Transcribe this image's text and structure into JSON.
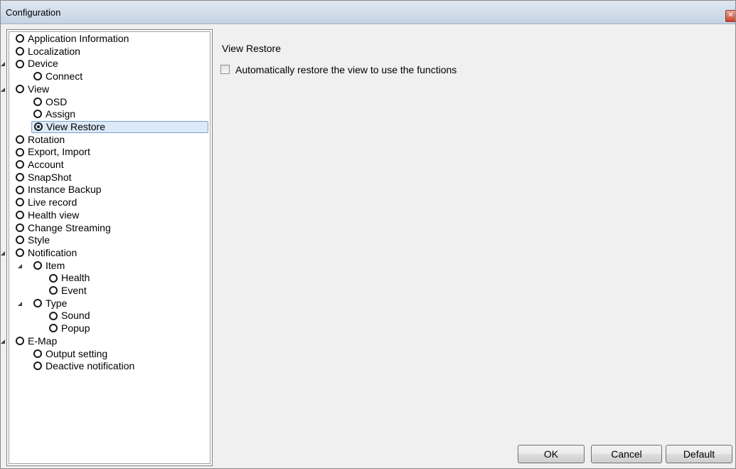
{
  "window": {
    "title": "Configuration",
    "close_icon": "close-icon"
  },
  "tree": {
    "items": [
      {
        "label": "Application Information",
        "level": 0,
        "expanded": null,
        "selected": false
      },
      {
        "label": "Localization",
        "level": 0,
        "expanded": null,
        "selected": false
      },
      {
        "label": "Device",
        "level": 0,
        "expanded": true,
        "selected": false
      },
      {
        "label": "Connect",
        "level": 1,
        "expanded": null,
        "selected": false
      },
      {
        "label": "View",
        "level": 0,
        "expanded": true,
        "selected": false
      },
      {
        "label": "OSD",
        "level": 1,
        "expanded": null,
        "selected": false
      },
      {
        "label": "Assign",
        "level": 1,
        "expanded": null,
        "selected": false
      },
      {
        "label": "View Restore",
        "level": 1,
        "expanded": null,
        "selected": true
      },
      {
        "label": "Rotation",
        "level": 0,
        "expanded": null,
        "selected": false
      },
      {
        "label": "Export, Import",
        "level": 0,
        "expanded": null,
        "selected": false
      },
      {
        "label": "Account",
        "level": 0,
        "expanded": null,
        "selected": false
      },
      {
        "label": "SnapShot",
        "level": 0,
        "expanded": null,
        "selected": false
      },
      {
        "label": "Instance Backup",
        "level": 0,
        "expanded": null,
        "selected": false
      },
      {
        "label": "Live record",
        "level": 0,
        "expanded": null,
        "selected": false
      },
      {
        "label": "Health view",
        "level": 0,
        "expanded": null,
        "selected": false
      },
      {
        "label": "Change Streaming",
        "level": 0,
        "expanded": null,
        "selected": false
      },
      {
        "label": "Style",
        "level": 0,
        "expanded": null,
        "selected": false
      },
      {
        "label": "Notification",
        "level": 0,
        "expanded": true,
        "selected": false
      },
      {
        "label": "Item",
        "level": 1,
        "expanded": true,
        "selected": false
      },
      {
        "label": "Health",
        "level": 2,
        "expanded": null,
        "selected": false
      },
      {
        "label": "Event",
        "level": 2,
        "expanded": null,
        "selected": false
      },
      {
        "label": "Type",
        "level": 1,
        "expanded": true,
        "selected": false
      },
      {
        "label": "Sound",
        "level": 2,
        "expanded": null,
        "selected": false
      },
      {
        "label": "Popup",
        "level": 2,
        "expanded": null,
        "selected": false
      },
      {
        "label": "E-Map",
        "level": 0,
        "expanded": true,
        "selected": false
      },
      {
        "label": "Output setting",
        "level": 1,
        "expanded": null,
        "selected": false
      },
      {
        "label": "Deactive notification",
        "level": 1,
        "expanded": null,
        "selected": false
      }
    ]
  },
  "content": {
    "section_title": "View Restore",
    "auto_restore": {
      "label": "Automatically restore the view to use the functions",
      "checked": false
    }
  },
  "buttons": {
    "ok": "OK",
    "cancel": "Cancel",
    "default": "Default"
  }
}
